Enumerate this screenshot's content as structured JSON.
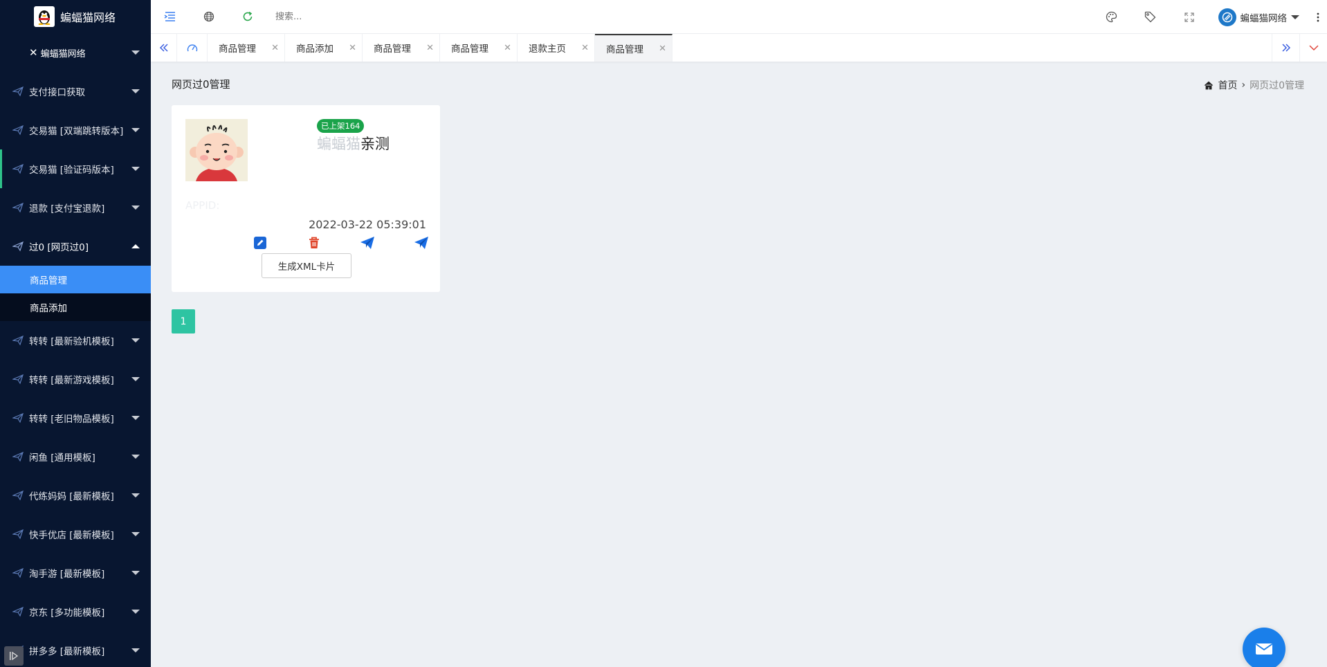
{
  "brand": {
    "name": "蝙蝠猫网络"
  },
  "sidebar": {
    "user_label": "蝙蝠猫网络",
    "menu": [
      {
        "label": "支付接口获取"
      },
      {
        "label": "交易猫 [双端跳转版本]"
      },
      {
        "label": "交易猫 [验证码版本]"
      },
      {
        "label": "退款 [支付宝退款]"
      },
      {
        "label": "过0 [网页过0]"
      },
      {
        "label": "转转 [最新验机模板]"
      },
      {
        "label": "转转 [最新游戏模板]"
      },
      {
        "label": "转转 [老旧物品模板]"
      },
      {
        "label": "闲鱼 [通用模板]"
      },
      {
        "label": "代练妈妈 [最新模板]"
      },
      {
        "label": "快手优店 [最新模板]"
      },
      {
        "label": "淘手游 [最新模板]"
      },
      {
        "label": "京东 [多功能模板]"
      },
      {
        "label": "拼多多 [最新模板]"
      }
    ],
    "submenu": [
      {
        "label": "商品管理"
      },
      {
        "label": "商品添加"
      }
    ]
  },
  "topbar": {
    "search_placeholder": "搜索...",
    "account_name": "蝙蝠猫网络"
  },
  "tabs": [
    {
      "label": "商品管理"
    },
    {
      "label": "商品添加"
    },
    {
      "label": "商品管理"
    },
    {
      "label": "商品管理"
    },
    {
      "label": "退款主页"
    },
    {
      "label": "商品管理"
    }
  ],
  "page": {
    "title": "网页过0管理",
    "breadcrumb_home": "首页",
    "breadcrumb_current": "网页过0管理"
  },
  "card": {
    "badge": "已上架164",
    "title_faded": "蝙蝠猫",
    "title_main": "亲测",
    "appid_label": "APPID:",
    "date": "2022-03-22 05:39:01",
    "xml_button": "生成XML卡片"
  },
  "pager": {
    "current": "1"
  },
  "colors": {
    "sidebar_bg": "#081630",
    "active_item": "#3a8ef6",
    "badge": "#1aa34a",
    "pager": "#2ec4a2",
    "fab": "#1a7fea"
  }
}
